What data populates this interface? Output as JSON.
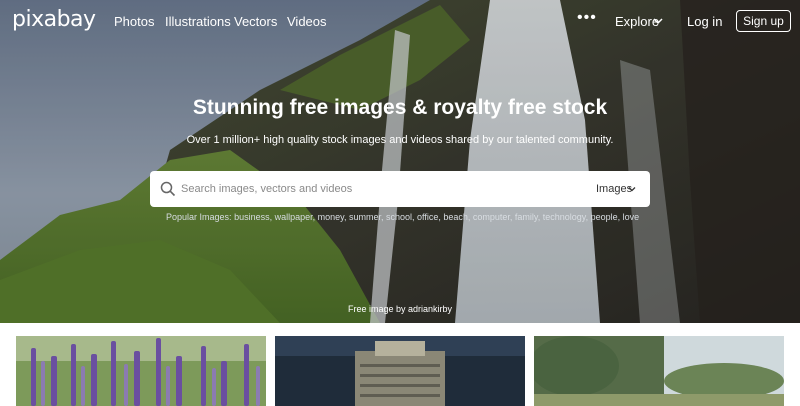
{
  "nav": {
    "logo": "pixabay",
    "links": [
      "Photos",
      "Illustrations",
      "Vectors",
      "Videos"
    ],
    "more_icon": "ellipsis-icon",
    "explore": "Explore",
    "login": "Log in",
    "signup": "Sign up"
  },
  "hero": {
    "title": "Stunning free images & royalty free stock",
    "subtitle": "Over 1 million+ high quality stock images and videos shared by our talented community.",
    "credit": "Free image by adriankirby"
  },
  "search": {
    "placeholder": "Search images, vectors and videos",
    "value": "",
    "type": "Images"
  },
  "popular": {
    "label": "Popular Images:",
    "terms": "business, wallpaper, money, summer, school, office, beach, computer, family, technology, people, love"
  },
  "colors": {
    "accent": "#ffffff",
    "hero_sky": "#7f8da2",
    "hero_grass": "#5c7a32"
  }
}
